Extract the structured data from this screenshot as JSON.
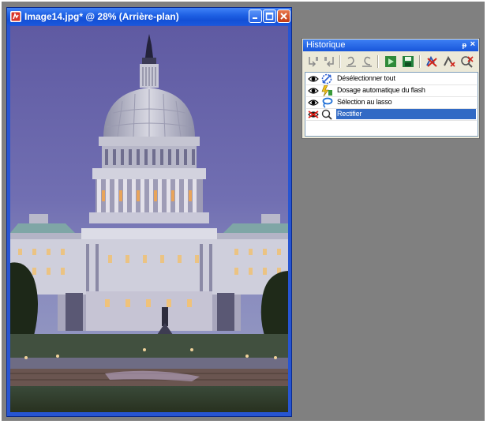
{
  "document_window": {
    "title": "Image14.jpg* @  28% (Arrière-plan)",
    "app_icon": "psp-app-icon",
    "buttons": [
      "minimize-icon",
      "maximize-icon",
      "close-icon"
    ]
  },
  "history_palette": {
    "title": "Historique",
    "pin_glyph": "ᵽ",
    "close_glyph": "×",
    "toolbar_icons": [
      "undo-to-here-icon",
      "redo-to-here-icon",
      "undo-selected-icon",
      "redo-selected-icon",
      "quickscript-icon",
      "save-script-icon",
      "clear-history-icon",
      "clear-non-undoable-icon",
      "delete-history-icon"
    ],
    "items": [
      {
        "label": "Désélectionner tout",
        "icon": "deselect-icon",
        "visible": true,
        "selected": false
      },
      {
        "label": "Dosage automatique du flash",
        "icon": "fill-flash-icon",
        "visible": true,
        "selected": false
      },
      {
        "label": "Sélection au lasso",
        "icon": "lasso-icon",
        "visible": true,
        "selected": false
      },
      {
        "label": "Rectifier",
        "icon": "straighten-icon",
        "visible": false,
        "selected": true
      }
    ]
  },
  "colors": {
    "workspace": "#808080",
    "titlebar_blue": "#1c5ee2",
    "selection": "#316ac5",
    "palette_bg": "#ece9d8"
  }
}
